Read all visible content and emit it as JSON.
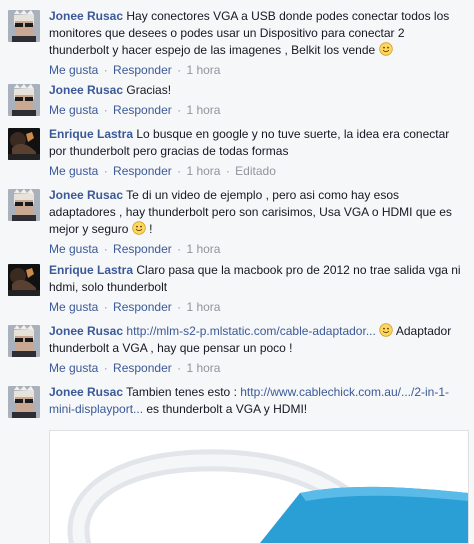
{
  "actions": {
    "like": "Me gusta",
    "reply": "Responder",
    "separator": "·"
  },
  "colors": {
    "author": "#3b5998",
    "meta": "#90949c",
    "cable": "#2a9fd6"
  },
  "comments": [
    {
      "author": "Jonee Rusac",
      "text": "Hay conectores VGA a USB donde podes conectar todos los monitores que desees o podes usar un Dispositivo para conectar 2 thunderbolt y hacer espejo de las imagenes , Belkit los vende",
      "trailing_emoji": "smiley-icon",
      "time": "1 hora"
    },
    {
      "author": "Jonee Rusac",
      "text": "Gracias!",
      "time": "1 hora"
    },
    {
      "author": "Enrique Lastra",
      "text": "Lo busque en google y no tuve suerte, la idea era conectar por thunderbolt pero gracias de todas formas",
      "time": "1 hora",
      "edited": "Editado"
    },
    {
      "author": "Jonee Rusac",
      "text_before": "Te di un video de ejemplo , pero asi como hay esos adaptadores , hay thunderbolt pero son carisimos, Usa VGA o HDMI que es mejor y seguro",
      "text_after": "!",
      "time": "1 hora"
    },
    {
      "author": "Enrique Lastra",
      "text": "Claro pasa que la macbook pro de 2012 no trae salida vga ni hdmi, solo thunderbolt",
      "time": "1 hora"
    },
    {
      "author": "Jonee Rusac",
      "link": "http://mlm-s2-p.mlstatic.com/cable-adaptador...",
      "text_after": "Adaptador thunderbolt a VGA , hay que pensar un poco !",
      "time": "1 hora"
    },
    {
      "author": "Jonee Rusac",
      "text_before": "Tambien tenes esto :",
      "link": "http://www.cablechick.com.au/.../2-in-1-mini-displayport...",
      "text_after": "es thunderbolt a VGA y HDMI!",
      "time": "1 hora",
      "preview_image": "cable-photo"
    }
  ]
}
